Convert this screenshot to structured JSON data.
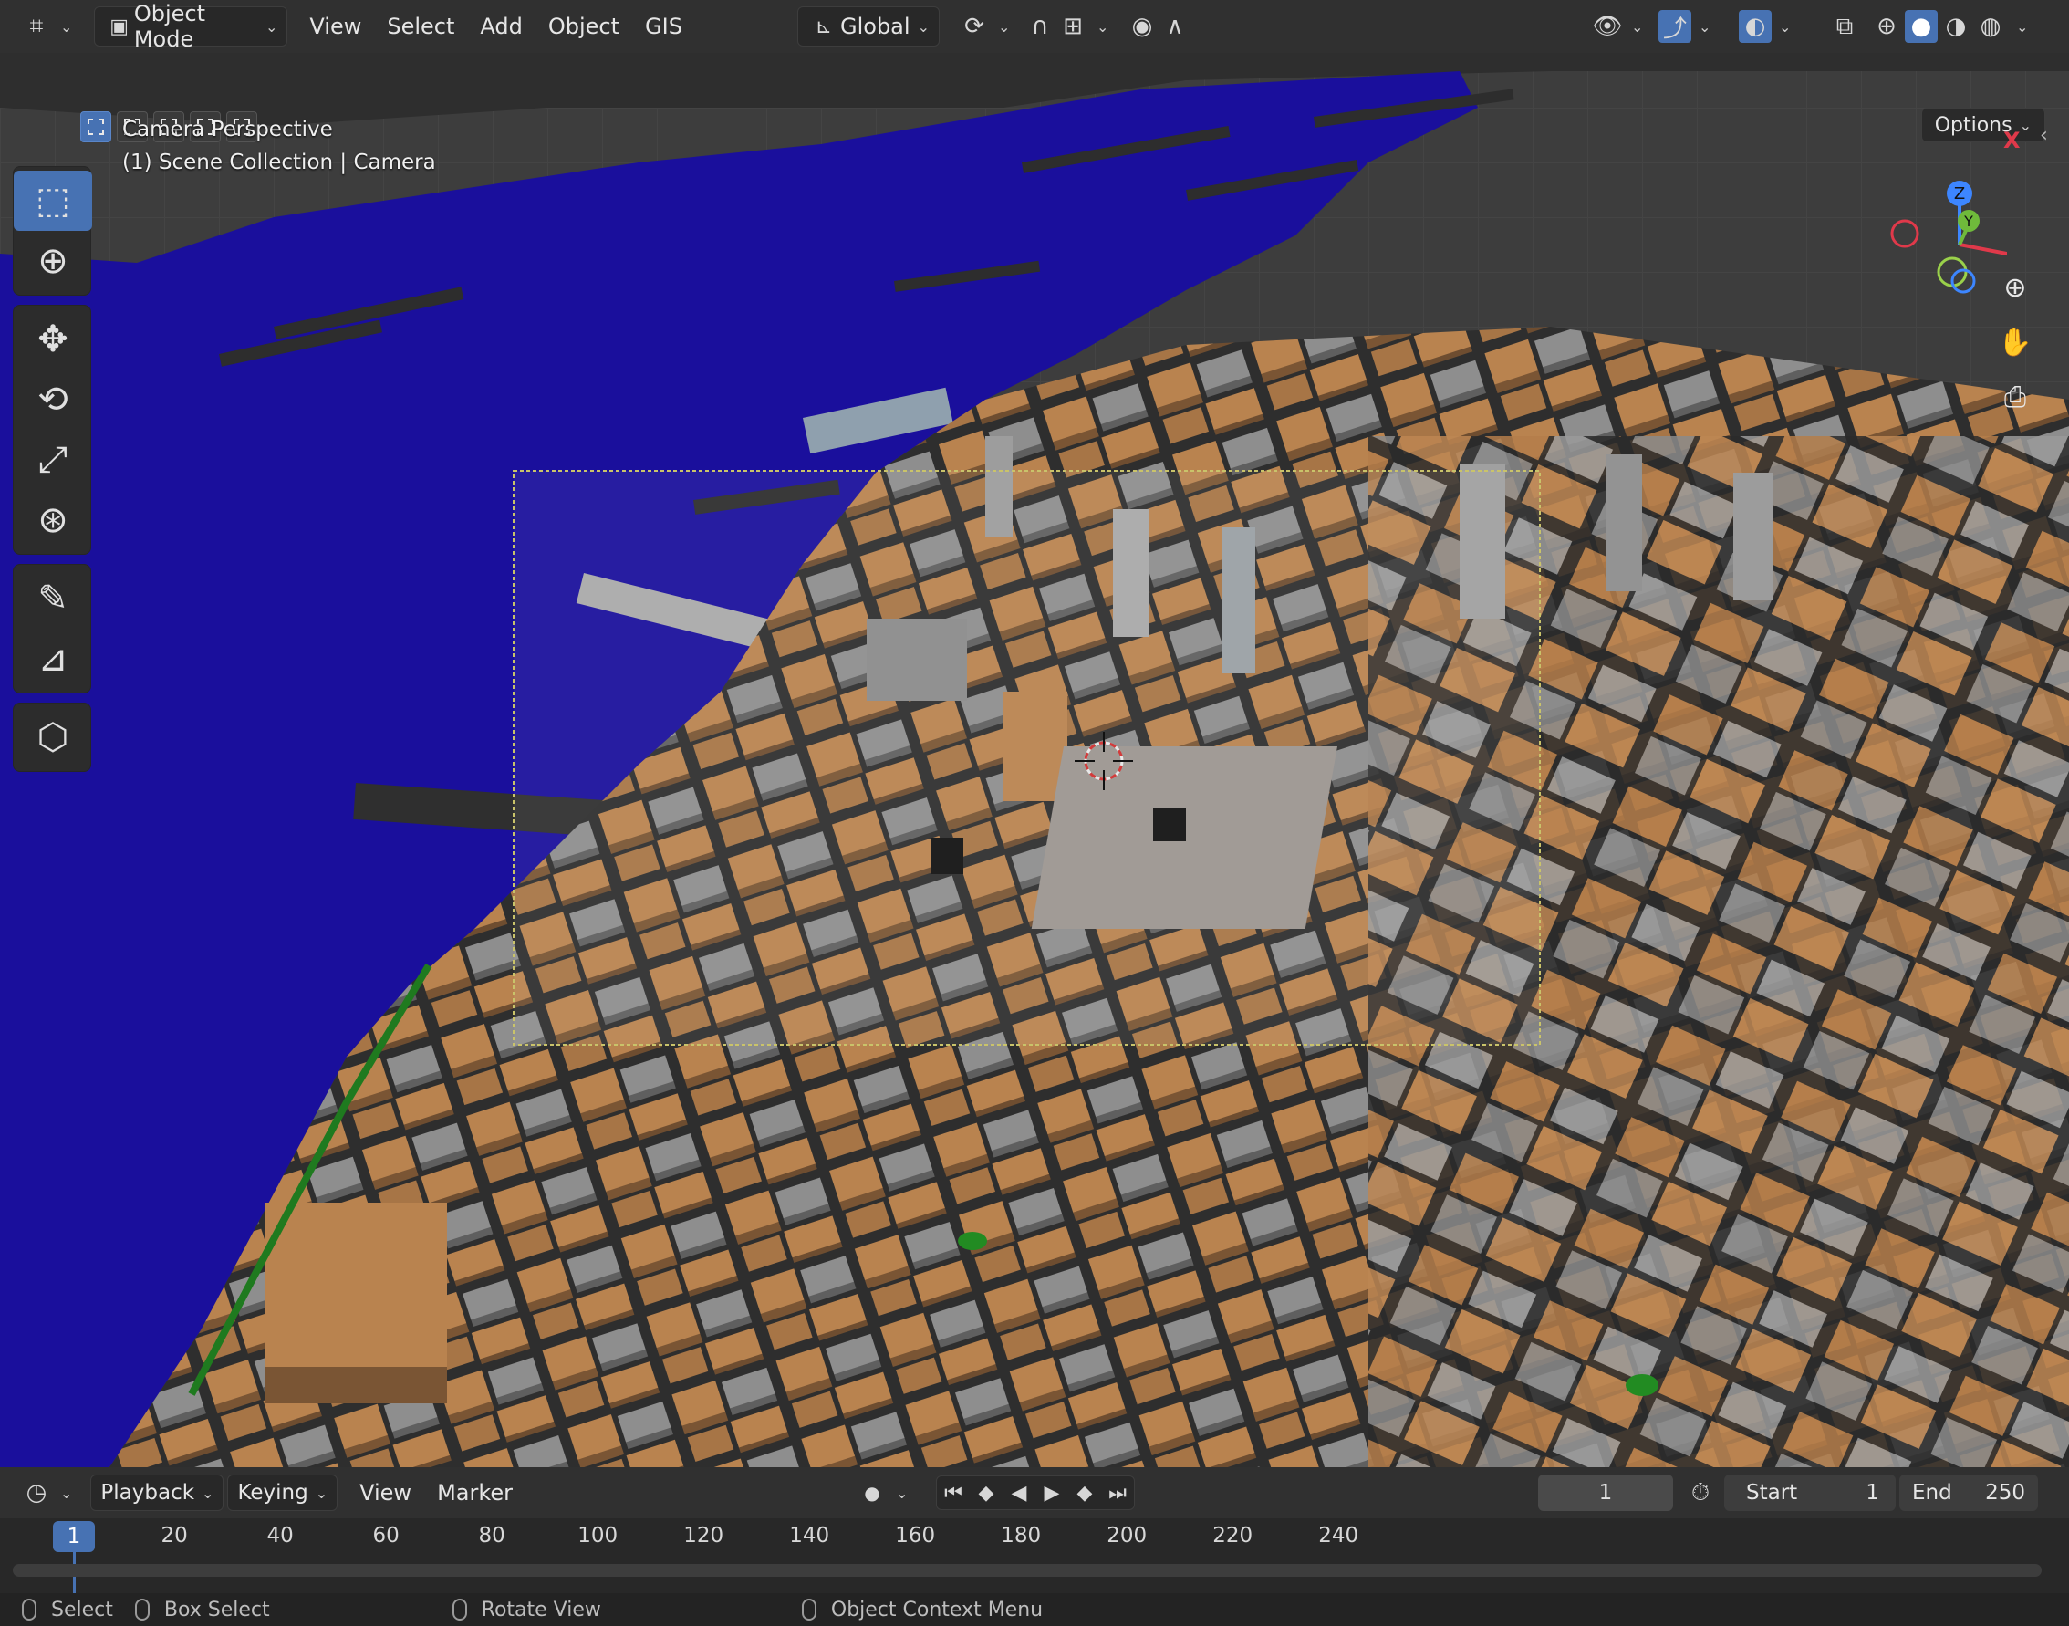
{
  "header": {
    "mode": "Object Mode",
    "menu": [
      "View",
      "Select",
      "Add",
      "Object",
      "GIS"
    ],
    "orientation": "Global"
  },
  "viewport": {
    "view_name": "Camera Perspective",
    "collection_line": "(1) Scene Collection | Camera",
    "options_label": "Options",
    "gizmo": {
      "x": "X",
      "y": "Y",
      "z": "Z"
    },
    "colors": {
      "water": "#1a0f9c",
      "building_orange": "#b9834f",
      "building_gray": "#8e8e8e",
      "ground": "#3d3d3d"
    }
  },
  "toolbar": {
    "tools": [
      "select-box",
      "cursor",
      "move",
      "rotate",
      "scale",
      "transform",
      "annotate",
      "measure",
      "add-cube"
    ]
  },
  "timeline": {
    "menu": [
      "Playback",
      "Keying",
      "View",
      "Marker"
    ],
    "current_frame": "1",
    "start_label": "Start",
    "start_value": "1",
    "end_label": "End",
    "end_value": "250",
    "ticks": [
      "20",
      "40",
      "60",
      "80",
      "100",
      "120",
      "140",
      "160",
      "180",
      "200",
      "220",
      "240"
    ],
    "playhead": "1"
  },
  "statusbar": {
    "select": "Select",
    "box_select": "Box Select",
    "rotate_view": "Rotate View",
    "context_menu": "Object Context Menu"
  }
}
